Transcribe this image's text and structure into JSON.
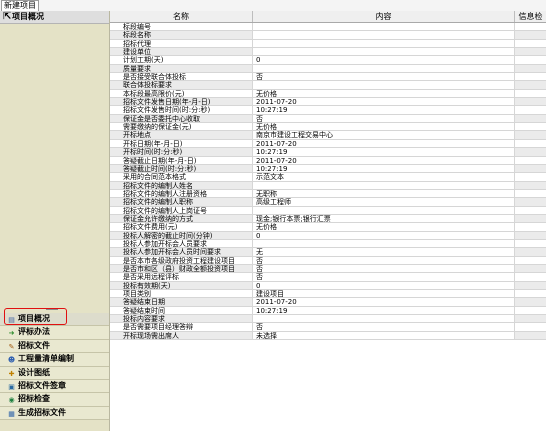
{
  "tab": {
    "label": "新建项目"
  },
  "sidebar": {
    "header": "项目概况",
    "items": [
      {
        "label": "项目概况",
        "icon": "doc-icon",
        "selected": true
      },
      {
        "label": "评标办法",
        "icon": "arrow-icon"
      },
      {
        "label": "招标文件",
        "icon": "pencil-icon"
      },
      {
        "label": "工程量清单编制",
        "icon": "people-icon"
      },
      {
        "label": "设计图纸",
        "icon": "marker-icon"
      },
      {
        "label": "招标文件签章",
        "icon": "stamp-icon"
      },
      {
        "label": "招标检查",
        "icon": "check-icon"
      },
      {
        "label": "生成招标文件",
        "icon": "table-icon"
      }
    ]
  },
  "grid": {
    "headers": [
      "名称",
      "内容",
      "信息检查"
    ],
    "rows": [
      {
        "name": "标段编号",
        "value": ""
      },
      {
        "name": "标段名称",
        "value": ""
      },
      {
        "name": "招标代理",
        "value": ""
      },
      {
        "name": "建设单位",
        "value": ""
      },
      {
        "name": "计划工期(天)",
        "value": "0"
      },
      {
        "name": "质量要求",
        "value": ""
      },
      {
        "name": "是否接受联合体投标",
        "value": "否"
      },
      {
        "name": "联合体投标要求",
        "value": ""
      },
      {
        "name": "本标段最高限价(元)",
        "value": "无价格"
      },
      {
        "name": "招标文件发售日期(年-月-日)",
        "value": "2011-07-20"
      },
      {
        "name": "招标文件发售时间(时:分:秒)",
        "value": "10:27:19"
      },
      {
        "name": "保证金是否委托中心收取",
        "value": "否"
      },
      {
        "name": "需要缴纳的保证金(元)",
        "value": "无价格"
      },
      {
        "name": "开标地点",
        "value": "南京市建设工程交易中心"
      },
      {
        "name": "开标日期(年-月-日)",
        "value": "2011-07-20"
      },
      {
        "name": "开标时间(时:分:秒)",
        "value": "10:27:19"
      },
      {
        "name": "答疑截止日期(年-月-日)",
        "value": "2011-07-20"
      },
      {
        "name": "答疑截止时间(时:分:秒)",
        "value": "10:27:19"
      },
      {
        "name": "采用的合同范本格式",
        "value": "示范文本"
      },
      {
        "name": "招标文件的编制人姓名",
        "value": ""
      },
      {
        "name": "招标文件的编制人注册资格",
        "value": "无职称"
      },
      {
        "name": "招标文件的编制人职称",
        "value": "高级工程师"
      },
      {
        "name": "招标文件的编制人上岗证号",
        "value": ""
      },
      {
        "name": "保证金允许缴纳的方式",
        "value": "现金;银行本票;银行汇票"
      },
      {
        "name": "招标文件费用(元)",
        "value": "无价格"
      },
      {
        "name": "投标人解密的截止时间(分钟)",
        "value": "0"
      },
      {
        "name": "投标人参加开标会人员要求",
        "value": ""
      },
      {
        "name": "投标人参加开标会人员时间要求",
        "value": "无"
      },
      {
        "name": "是否本市各级政府投资工程建设项目",
        "value": "否"
      },
      {
        "name": "是否市和区（县）财政全额投资项目",
        "value": "否"
      },
      {
        "name": "是否采用远程评标",
        "value": "否"
      },
      {
        "name": "投标有效期(天)",
        "value": "0"
      },
      {
        "name": "项目类别",
        "value": "建设项目"
      },
      {
        "name": "答疑结束日期",
        "value": "2011-07-20"
      },
      {
        "name": "答疑结束时间",
        "value": "10:27:19"
      },
      {
        "name": "投标内容要求",
        "value": ""
      },
      {
        "name": "是否需要项目经理答辩",
        "value": "否"
      },
      {
        "name": "开标现场需出席人",
        "value": "未选择"
      }
    ]
  }
}
